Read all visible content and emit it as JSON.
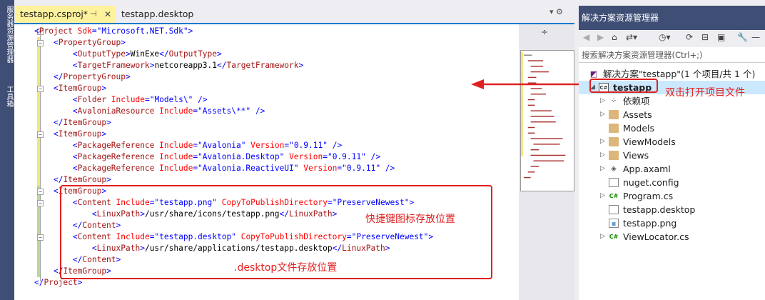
{
  "editor": {
    "tabs": [
      {
        "label": "testapp.csproj*",
        "active": true
      },
      {
        "label": "testapp.desktop",
        "active": false
      }
    ],
    "tab_pin_icon": "pin-icon",
    "tab_close_icon": "close-icon",
    "tools_label": "▾ ⚙",
    "minimap_split_icon": "split-icon",
    "lines": [
      [
        [
          "b",
          "<"
        ],
        [
          "g",
          "Project"
        ],
        [
          "a",
          " Sdk"
        ],
        [
          "b",
          "=\""
        ],
        [
          "v",
          "Microsoft.NET.Sdk"
        ],
        [
          "b",
          "\">"
        ]
      ],
      [
        [
          "s",
          "    "
        ],
        [
          "b",
          "<"
        ],
        [
          "g",
          "PropertyGroup"
        ],
        [
          "b",
          ">"
        ]
      ],
      [
        [
          "s",
          "        "
        ],
        [
          "b",
          "<"
        ],
        [
          "g",
          "OutputType"
        ],
        [
          "b",
          ">"
        ],
        [
          "t",
          "WinExe"
        ],
        [
          "b",
          "</"
        ],
        [
          "g",
          "OutputType"
        ],
        [
          "b",
          ">"
        ]
      ],
      [
        [
          "s",
          "        "
        ],
        [
          "b",
          "<"
        ],
        [
          "g",
          "TargetFramework"
        ],
        [
          "b",
          ">"
        ],
        [
          "t",
          "netcoreapp3.1"
        ],
        [
          "b",
          "</"
        ],
        [
          "g",
          "TargetFramework"
        ],
        [
          "b",
          ">"
        ]
      ],
      [
        [
          "s",
          "    "
        ],
        [
          "b",
          "</"
        ],
        [
          "g",
          "PropertyGroup"
        ],
        [
          "b",
          ">"
        ]
      ],
      [
        [
          "s",
          "    "
        ],
        [
          "b",
          "<"
        ],
        [
          "g",
          "ItemGroup"
        ],
        [
          "b",
          ">"
        ]
      ],
      [
        [
          "s",
          "        "
        ],
        [
          "b",
          "<"
        ],
        [
          "g",
          "Folder"
        ],
        [
          "a",
          " Include"
        ],
        [
          "b",
          "=\""
        ],
        [
          "v",
          "Models\\"
        ],
        [
          "b",
          "\" />"
        ]
      ],
      [
        [
          "s",
          "        "
        ],
        [
          "b",
          "<"
        ],
        [
          "g",
          "AvaloniaResource"
        ],
        [
          "a",
          " Include"
        ],
        [
          "b",
          "=\""
        ],
        [
          "v",
          "Assets\\**"
        ],
        [
          "b",
          "\" />"
        ]
      ],
      [
        [
          "s",
          "    "
        ],
        [
          "b",
          "</"
        ],
        [
          "g",
          "ItemGroup"
        ],
        [
          "b",
          ">"
        ]
      ],
      [
        [
          "s",
          "    "
        ],
        [
          "b",
          "<"
        ],
        [
          "g",
          "ItemGroup"
        ],
        [
          "b",
          ">"
        ]
      ],
      [
        [
          "s",
          "        "
        ],
        [
          "b",
          "<"
        ],
        [
          "g",
          "PackageReference"
        ],
        [
          "a",
          " Include"
        ],
        [
          "b",
          "=\""
        ],
        [
          "v",
          "Avalonia"
        ],
        [
          "b",
          "\""
        ],
        [
          "a",
          " Version"
        ],
        [
          "b",
          "=\""
        ],
        [
          "v",
          "0.9.11"
        ],
        [
          "b",
          "\" />"
        ]
      ],
      [
        [
          "s",
          "        "
        ],
        [
          "b",
          "<"
        ],
        [
          "g",
          "PackageReference"
        ],
        [
          "a",
          " Include"
        ],
        [
          "b",
          "=\""
        ],
        [
          "v",
          "Avalonia.Desktop"
        ],
        [
          "b",
          "\""
        ],
        [
          "a",
          " Version"
        ],
        [
          "b",
          "=\""
        ],
        [
          "v",
          "0.9.11"
        ],
        [
          "b",
          "\" />"
        ]
      ],
      [
        [
          "s",
          "        "
        ],
        [
          "b",
          "<"
        ],
        [
          "g",
          "PackageReference"
        ],
        [
          "a",
          " Include"
        ],
        [
          "b",
          "=\""
        ],
        [
          "v",
          "Avalonia.ReactiveUI"
        ],
        [
          "b",
          "\""
        ],
        [
          "a",
          " Version"
        ],
        [
          "b",
          "=\""
        ],
        [
          "v",
          "0.9.11"
        ],
        [
          "b",
          "\" />"
        ]
      ],
      [
        [
          "s",
          "    "
        ],
        [
          "b",
          "</"
        ],
        [
          "g",
          "ItemGroup"
        ],
        [
          "b",
          ">"
        ]
      ],
      [
        [
          "s",
          "    "
        ],
        [
          "b",
          "<"
        ],
        [
          "g",
          "ItemGroup"
        ],
        [
          "b",
          ">"
        ]
      ],
      [
        [
          "s",
          "        "
        ],
        [
          "b",
          "<"
        ],
        [
          "g",
          "Content"
        ],
        [
          "a",
          " Include"
        ],
        [
          "b",
          "=\""
        ],
        [
          "v",
          "testapp.png"
        ],
        [
          "b",
          "\""
        ],
        [
          "a",
          " CopyToPublishDirectory"
        ],
        [
          "b",
          "=\""
        ],
        [
          "v",
          "PreserveNewest"
        ],
        [
          "b",
          "\">"
        ]
      ],
      [
        [
          "s",
          "            "
        ],
        [
          "b",
          "<"
        ],
        [
          "g",
          "LinuxPath"
        ],
        [
          "b",
          ">"
        ],
        [
          "t",
          "/usr/share/icons/testapp.png"
        ],
        [
          "b",
          "</"
        ],
        [
          "g",
          "LinuxPath"
        ],
        [
          "b",
          ">"
        ]
      ],
      [
        [
          "s",
          "        "
        ],
        [
          "b",
          "</"
        ],
        [
          "g",
          "Content"
        ],
        [
          "b",
          ">"
        ]
      ],
      [
        [
          "s",
          "        "
        ],
        [
          "b",
          "<"
        ],
        [
          "g",
          "Content"
        ],
        [
          "a",
          " Include"
        ],
        [
          "b",
          "=\""
        ],
        [
          "v",
          "testapp.desktop"
        ],
        [
          "b",
          "\""
        ],
        [
          "a",
          " CopyToPublishDirectory"
        ],
        [
          "b",
          "=\""
        ],
        [
          "v",
          "PreserveNewest"
        ],
        [
          "b",
          "\">"
        ]
      ],
      [
        [
          "s",
          "            "
        ],
        [
          "b",
          "<"
        ],
        [
          "g",
          "LinuxPath"
        ],
        [
          "b",
          ">"
        ],
        [
          "t",
          "/usr/share/applications/testapp.desktop"
        ],
        [
          "b",
          "</"
        ],
        [
          "g",
          "LinuxPath"
        ],
        [
          "b",
          ">"
        ]
      ],
      [
        [
          "s",
          "        "
        ],
        [
          "b",
          "</"
        ],
        [
          "g",
          "Content"
        ],
        [
          "b",
          ">"
        ]
      ],
      [
        [
          "s",
          "    "
        ],
        [
          "b",
          "</"
        ],
        [
          "g",
          "ItemGroup"
        ],
        [
          "b",
          ">"
        ]
      ],
      [
        [
          "b",
          "</"
        ],
        [
          "g",
          "Project"
        ],
        [
          "b",
          ">"
        ]
      ]
    ]
  },
  "annotations": {
    "icon_path_label": "快捷键图标存放位置",
    "desktop_path_label": ".desktop文件存放位置",
    "project_hint": "双击打开项目文件"
  },
  "side_tabs": {
    "server_explorer": "服务器资源管理器",
    "toolbox": "工具箱"
  },
  "solution_explorer": {
    "title": "解决方案资源管理器",
    "search_placeholder": "搜索解决方案资源管理器(Ctrl+;)",
    "toolbar_icons": [
      "back-icon",
      "forward-icon",
      "home-icon",
      "sync-icon",
      "history-icon",
      "refresh-icon",
      "collapse-icon",
      "properties-icon",
      "pin-icon"
    ],
    "tree": [
      {
        "label": "解决方案\"testapp\"(1 个项目/共 1 个)",
        "icon": "solution-icon",
        "level": 0,
        "arrow": "none",
        "selected": false
      },
      {
        "label": "testapp",
        "icon": "csproj-icon",
        "level": 1,
        "arrow": "expanded",
        "selected": true
      },
      {
        "label": "依赖项",
        "icon": "dependencies-icon",
        "level": 2,
        "arrow": "collapsed",
        "selected": false
      },
      {
        "label": "Assets",
        "icon": "folder-icon",
        "level": 2,
        "arrow": "collapsed",
        "selected": false
      },
      {
        "label": "Models",
        "icon": "folder-icon",
        "level": 2,
        "arrow": "none",
        "selected": false
      },
      {
        "label": "ViewModels",
        "icon": "folder-icon",
        "level": 2,
        "arrow": "collapsed",
        "selected": false
      },
      {
        "label": "Views",
        "icon": "folder-icon",
        "level": 2,
        "arrow": "collapsed",
        "selected": false
      },
      {
        "label": "App.axaml",
        "icon": "axaml-icon",
        "level": 2,
        "arrow": "collapsed",
        "selected": false
      },
      {
        "label": "nuget.config",
        "icon": "file-icon",
        "level": 2,
        "arrow": "none",
        "selected": false
      },
      {
        "label": "Program.cs",
        "icon": "cs-icon",
        "level": 2,
        "arrow": "collapsed",
        "selected": false
      },
      {
        "label": "testapp.desktop",
        "icon": "file-icon",
        "level": 2,
        "arrow": "none",
        "selected": false
      },
      {
        "label": "testapp.png",
        "icon": "image-icon",
        "level": 2,
        "arrow": "none",
        "selected": false
      },
      {
        "label": "ViewLocator.cs",
        "icon": "cs-icon",
        "level": 2,
        "arrow": "collapsed",
        "selected": false
      }
    ]
  },
  "colors": {
    "accent": "#007acc",
    "tool_window_header": "#3f4e75",
    "annotation_red": "#e02020",
    "xml_bracket": "#0000ff",
    "xml_tag": "#a31515",
    "xml_attr": "#ff0000",
    "selection": "#cce8ff"
  }
}
